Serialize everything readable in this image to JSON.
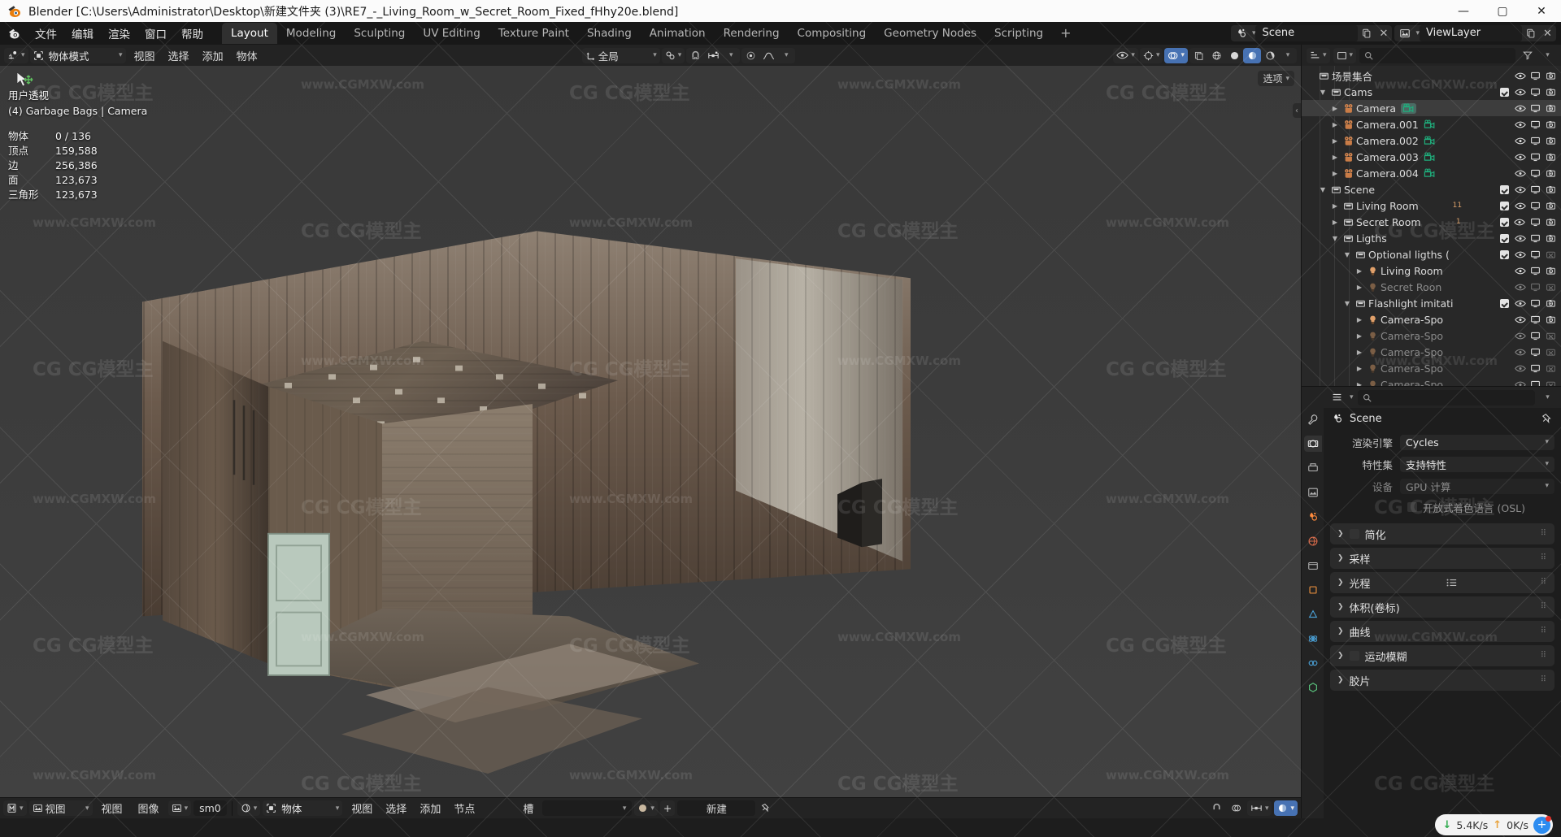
{
  "window": {
    "title": "Blender [C:\\Users\\Administrator\\Desktop\\新建文件夹 (3)\\RE7_-_Living_Room_w_Secret_Room_Fixed_fHhy20e.blend]",
    "minimize": "—",
    "maximize": "▢",
    "close": "✕"
  },
  "topbar": {
    "menus": [
      "文件",
      "编辑",
      "渲染",
      "窗口",
      "帮助"
    ],
    "workspaces": [
      {
        "label": "Layout",
        "active": true
      },
      {
        "label": "Modeling",
        "active": false
      },
      {
        "label": "Sculpting",
        "active": false
      },
      {
        "label": "UV Editing",
        "active": false
      },
      {
        "label": "Texture Paint",
        "active": false
      },
      {
        "label": "Shading",
        "active": false
      },
      {
        "label": "Animation",
        "active": false
      },
      {
        "label": "Rendering",
        "active": false
      },
      {
        "label": "Compositing",
        "active": false
      },
      {
        "label": "Geometry Nodes",
        "active": false
      },
      {
        "label": "Scripting",
        "active": false
      }
    ],
    "add_workspace": "+",
    "scene_name": "Scene",
    "viewlayer_name": "ViewLayer"
  },
  "viewport_header": {
    "mode": "物体模式",
    "menus": [
      "视图",
      "选择",
      "添加",
      "物体"
    ],
    "transform_orientation": "全局",
    "options_label": "选项"
  },
  "viewport": {
    "view_name": "用户透视",
    "active_object": "(4) Garbage Bags | Camera",
    "stats": [
      {
        "key": "物体",
        "value": "0 / 136"
      },
      {
        "key": "顶点",
        "value": "159,588"
      },
      {
        "key": "边",
        "value": "256,386"
      },
      {
        "key": "面",
        "value": "123,673"
      },
      {
        "key": "三角形",
        "value": "123,673"
      }
    ]
  },
  "outliner": {
    "rows": [
      {
        "indent": 0,
        "disclosure": "",
        "icon": "collection-icon",
        "label": "场景集合",
        "checkbox": false,
        "eye": false,
        "screen": false,
        "camera": false,
        "dim": false
      },
      {
        "indent": 1,
        "disclosure": "▼",
        "icon": "collection-icon",
        "label": "Cams",
        "checkbox": true,
        "eye": true,
        "screen": true,
        "camera": true,
        "dim": false
      },
      {
        "indent": 2,
        "disclosure": "▶",
        "icon": "camera-object-icon",
        "label": "Camera",
        "checkbox": false,
        "eye": true,
        "screen": true,
        "camera": true,
        "dim": false,
        "selected": true,
        "data_icon": "camera-data-icon"
      },
      {
        "indent": 2,
        "disclosure": "▶",
        "icon": "camera-object-icon",
        "label": "Camera.001",
        "checkbox": false,
        "eye": true,
        "screen": true,
        "camera": true,
        "dim": false,
        "data_icon": "camera-data-icon"
      },
      {
        "indent": 2,
        "disclosure": "▶",
        "icon": "camera-object-icon",
        "label": "Camera.002",
        "checkbox": false,
        "eye": true,
        "screen": true,
        "camera": true,
        "dim": false,
        "data_icon": "camera-data-icon"
      },
      {
        "indent": 2,
        "disclosure": "▶",
        "icon": "camera-object-icon",
        "label": "Camera.003",
        "checkbox": false,
        "eye": true,
        "screen": true,
        "camera": true,
        "dim": false,
        "data_icon": "camera-data-icon"
      },
      {
        "indent": 2,
        "disclosure": "▶",
        "icon": "camera-object-icon",
        "label": "Camera.004",
        "checkbox": false,
        "eye": true,
        "screen": true,
        "camera": true,
        "dim": false,
        "data_icon": "camera-data-icon"
      },
      {
        "indent": 1,
        "disclosure": "▼",
        "icon": "collection-icon",
        "label": "Scene",
        "checkbox": true,
        "eye": true,
        "screen": true,
        "camera": true,
        "dim": false
      },
      {
        "indent": 2,
        "disclosure": "▶",
        "icon": "collection-icon",
        "label": "Living Room",
        "checkbox": true,
        "eye": true,
        "screen": true,
        "camera": true,
        "dim": false,
        "badge": "11"
      },
      {
        "indent": 2,
        "disclosure": "▶",
        "icon": "collection-icon",
        "label": "Secret Room",
        "checkbox": true,
        "eye": true,
        "screen": true,
        "camera": true,
        "dim": false,
        "badge": "1"
      },
      {
        "indent": 2,
        "disclosure": "▼",
        "icon": "collection-icon",
        "label": "Ligths",
        "checkbox": true,
        "eye": true,
        "screen": true,
        "camera": true,
        "dim": false
      },
      {
        "indent": 3,
        "disclosure": "▼",
        "icon": "collection-icon",
        "label": "Optional ligths (",
        "checkbox": true,
        "eye": true,
        "screen": true,
        "camera_off": true,
        "dim": false
      },
      {
        "indent": 4,
        "disclosure": "▶",
        "icon": "light-icon",
        "label": "Living Room",
        "checkbox": false,
        "eye": true,
        "screen": true,
        "camera": true,
        "dim": false
      },
      {
        "indent": 4,
        "disclosure": "▶",
        "icon": "light-icon",
        "label": "Secret Roon",
        "checkbox": false,
        "eye": true,
        "screen_off": true,
        "camera_off": true,
        "dim": true
      },
      {
        "indent": 3,
        "disclosure": "▼",
        "icon": "collection-icon",
        "label": "Flashlight imitati",
        "checkbox": true,
        "eye": true,
        "screen": true,
        "camera": true,
        "dim": false
      },
      {
        "indent": 4,
        "disclosure": "▶",
        "icon": "light-icon",
        "label": "Camera-Spo",
        "checkbox": false,
        "eye": true,
        "screen": true,
        "camera": true,
        "dim": false
      },
      {
        "indent": 4,
        "disclosure": "▶",
        "icon": "light-icon",
        "label": "Camera-Spo",
        "checkbox": false,
        "eye": true,
        "screen": true,
        "camera_off": true,
        "dim": true
      },
      {
        "indent": 4,
        "disclosure": "▶",
        "icon": "light-icon",
        "label": "Camera-Spo",
        "checkbox": false,
        "eye": true,
        "screen": true,
        "camera_off": true,
        "dim": true
      },
      {
        "indent": 4,
        "disclosure": "▶",
        "icon": "light-icon",
        "label": "Camera-Spo",
        "checkbox": false,
        "eye": true,
        "screen": true,
        "camera_off": true,
        "dim": true
      },
      {
        "indent": 4,
        "disclosure": "▶",
        "icon": "light-icon",
        "label": "Camera-Spo",
        "checkbox": false,
        "eye": true,
        "screen": true,
        "camera_off": true,
        "dim": true
      }
    ]
  },
  "properties": {
    "breadcrumb": "Scene",
    "fields": [
      {
        "label": "渲染引擎",
        "value": "Cycles",
        "disabled": false
      },
      {
        "label": "特性集",
        "value": "支持特性",
        "disabled": false
      },
      {
        "label": "设备",
        "value": "GPU 计算",
        "disabled": true
      }
    ],
    "osl_label": "开放式着色语言 (OSL)",
    "panels": [
      {
        "label": "简化",
        "checkbox": true,
        "extra": false
      },
      {
        "label": "采样",
        "checkbox": false,
        "extra": false
      },
      {
        "label": "光程",
        "checkbox": false,
        "extra": true
      },
      {
        "label": "体积(卷标)",
        "checkbox": false,
        "extra": false
      },
      {
        "label": "曲线",
        "checkbox": false,
        "extra": false
      },
      {
        "label": "运动模糊",
        "checkbox": true,
        "extra": false
      },
      {
        "label": "胶片",
        "checkbox": false,
        "extra": false
      }
    ]
  },
  "bottom_editors": {
    "left_editor_menus": [
      "视图",
      "图像"
    ],
    "left_view_label": "视图",
    "image_name": "sm0",
    "node_mode": "物体",
    "node_menus": [
      "视图",
      "选择",
      "添加",
      "节点"
    ],
    "slot_label": "槽",
    "new_button": "新建"
  },
  "status": {
    "download_rate": "5.4K/s",
    "upload_rate": "0K/s",
    "down_arrow": "↓",
    "up_arrow": "↑",
    "plus": "+"
  },
  "watermark": {
    "brand": "CG模型主",
    "site": "www.CGMXW.com"
  },
  "colors": {
    "accent_blue": "#4772b3",
    "panel_bg": "#232323",
    "editor_bg": "#282828",
    "viewport_bg": "#3d3d3d",
    "camera_orange": "#d98a54",
    "camera_green": "#1fae7c"
  }
}
